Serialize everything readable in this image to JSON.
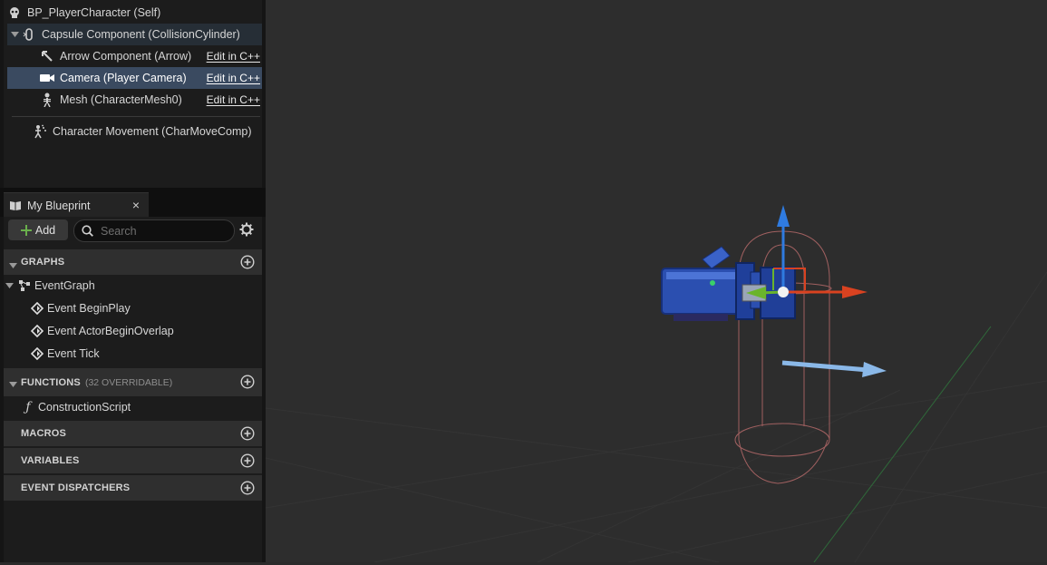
{
  "components": {
    "root": "BP_PlayerCharacter (Self)",
    "capsule": "Capsule Component (CollisionCylinder)",
    "arrow": "Arrow Component (Arrow)",
    "camera": "Camera (Player Camera)",
    "mesh": "Mesh (CharacterMesh0)",
    "movement": "Character Movement (CharMoveComp)",
    "edit_cpp": "Edit in C++"
  },
  "my_blueprint": {
    "tab_label": "My Blueprint",
    "close": "×",
    "add_label": "Add",
    "search_placeholder": "Search",
    "graphs_label": "GRAPHS",
    "event_graph": "EventGraph",
    "events": [
      "Event BeginPlay",
      "Event ActorBeginOverlap",
      "Event Tick"
    ],
    "functions_label": "FUNCTIONS",
    "functions_count": "(32 OVERRIDABLE)",
    "construction_script": "ConstructionScript",
    "macros_label": "MACROS",
    "variables_label": "VARIABLES",
    "dispatchers_label": "EVENT DISPATCHERS"
  },
  "icons": [
    "skull-icon",
    "capsule-icon",
    "arrow-icon",
    "camera-icon",
    "skeleton-icon",
    "movement-icon",
    "book-icon",
    "plus-icon",
    "search-icon",
    "gear-icon",
    "graph-icon",
    "event-icon",
    "function-icon",
    "add-circle-icon"
  ],
  "colors": {
    "selection": "#3a4a60",
    "add_plus": "#6ab04c",
    "gizmo_x": "#d94220",
    "gizmo_y": "#6ab42c",
    "gizmo_z": "#2f7be0",
    "camera_body": "#2b4fb0",
    "capsule_wire": "#a06060"
  }
}
